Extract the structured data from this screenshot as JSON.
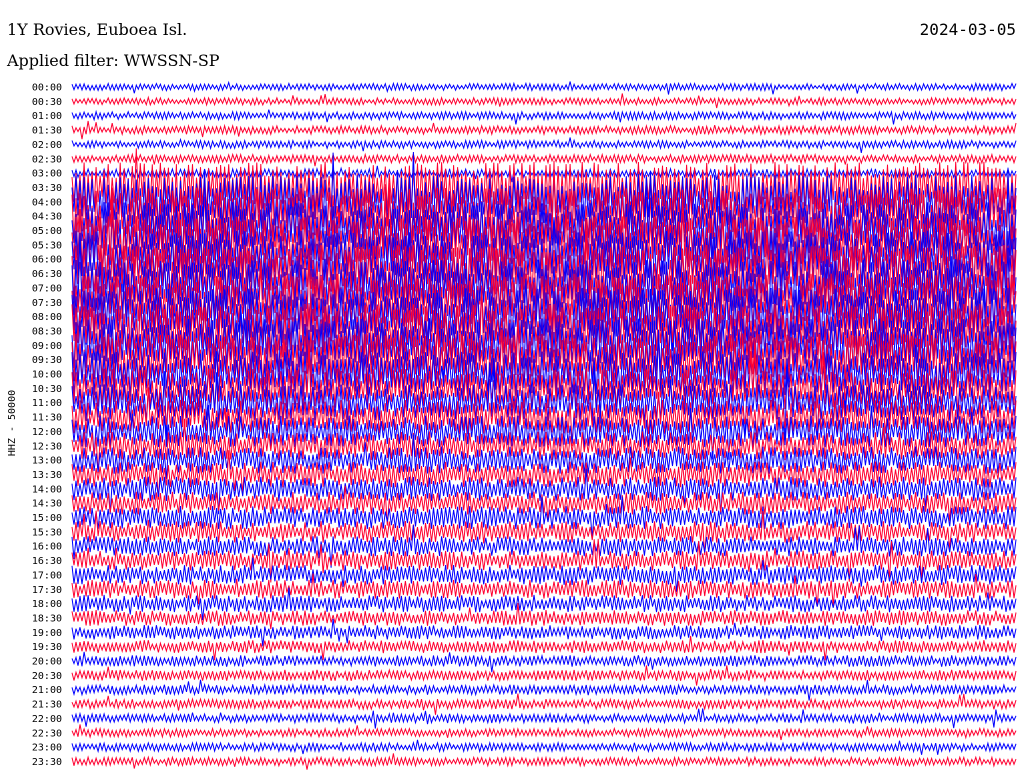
{
  "header": {
    "station": "1Y Rovies, Euboea Isl.",
    "filter": "Applied filter: WWSSN-SP",
    "date": "2024-03-05"
  },
  "chart_data": {
    "type": "line",
    "title": "1Y Rovies, Euboea Isl.",
    "subtitle": "Applied filter: WWSSN-SP",
    "date": "2024-03-05",
    "ylabel": "HHZ - 50000",
    "xlabel": "",
    "colors": [
      "#0000ff",
      "#ff0030"
    ],
    "categories": [
      "00:00",
      "00:30",
      "01:00",
      "01:30",
      "02:00",
      "02:30",
      "03:00",
      "03:30",
      "04:00",
      "04:30",
      "05:00",
      "05:30",
      "06:00",
      "06:30",
      "07:00",
      "07:30",
      "08:00",
      "08:30",
      "09:00",
      "09:30",
      "10:00",
      "10:30",
      "11:00",
      "11:30",
      "12:00",
      "12:30",
      "13:00",
      "13:30",
      "14:00",
      "14:30",
      "15:00",
      "15:30",
      "16:00",
      "16:30",
      "17:00",
      "17:30",
      "18:00",
      "18:30",
      "19:00",
      "19:30",
      "20:00",
      "20:30",
      "21:00",
      "21:30",
      "22:00",
      "22:30",
      "23:00",
      "23:30"
    ],
    "amplitude": [
      0.25,
      0.25,
      0.28,
      0.3,
      0.28,
      0.3,
      0.3,
      1.8,
      1.9,
      2,
      2,
      2,
      2,
      2,
      2,
      2,
      2,
      1.9,
      1.9,
      1.8,
      1.6,
      1.4,
      1.3,
      1.2,
      1.1,
      1,
      0.95,
      0.9,
      0.85,
      0.8,
      0.8,
      0.75,
      0.7,
      0.7,
      0.7,
      0.65,
      0.6,
      0.55,
      0.5,
      0.45,
      0.4,
      0.38,
      0.35,
      0.35,
      0.32,
      0.3,
      0.3,
      0.3
    ],
    "grid": false,
    "legend": "none"
  }
}
